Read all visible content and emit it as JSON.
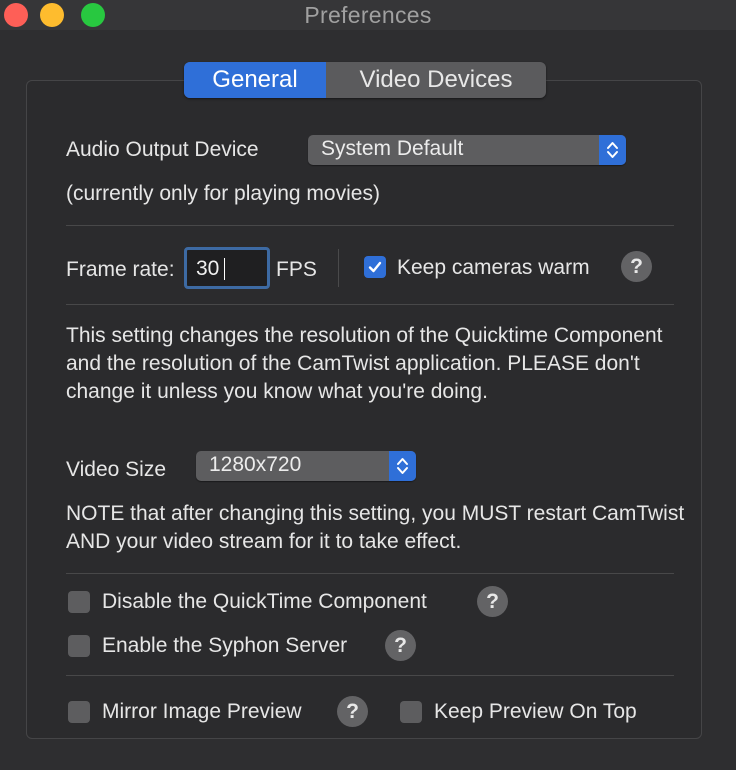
{
  "window": {
    "title": "Preferences"
  },
  "tabs": [
    {
      "label": "General",
      "active": true
    },
    {
      "label": "Video Devices",
      "active": false
    }
  ],
  "audio": {
    "label": "Audio Output Device",
    "selected": "System Default",
    "note": "(currently only for playing movies)"
  },
  "frame_rate": {
    "label": "Frame rate:",
    "value": "30",
    "unit": "FPS"
  },
  "keep_cameras_warm": {
    "label": "Keep cameras warm",
    "checked": true,
    "help": "?"
  },
  "resolution_note": "This setting changes the resolution of the Quicktime Component and the resolution of the CamTwist application.  PLEASE don't change it unless you know what you're doing.",
  "video_size": {
    "label": "Video Size",
    "selected": "1280x720"
  },
  "restart_note": "NOTE that after changing this setting, you MUST restart CamTwist AND your video stream for it to take effect.",
  "disable_quicktime": {
    "label": "Disable the QuickTime Component",
    "checked": false,
    "help": "?"
  },
  "enable_syphon": {
    "label": "Enable the Syphon Server",
    "checked": false,
    "help": "?"
  },
  "mirror_preview": {
    "label": "Mirror Image Preview",
    "checked": false,
    "help": "?"
  },
  "keep_preview_on_top": {
    "label": "Keep Preview On Top",
    "checked": false
  },
  "colors": {
    "accent": "#2f6fd8",
    "background": "#2e2e30"
  }
}
